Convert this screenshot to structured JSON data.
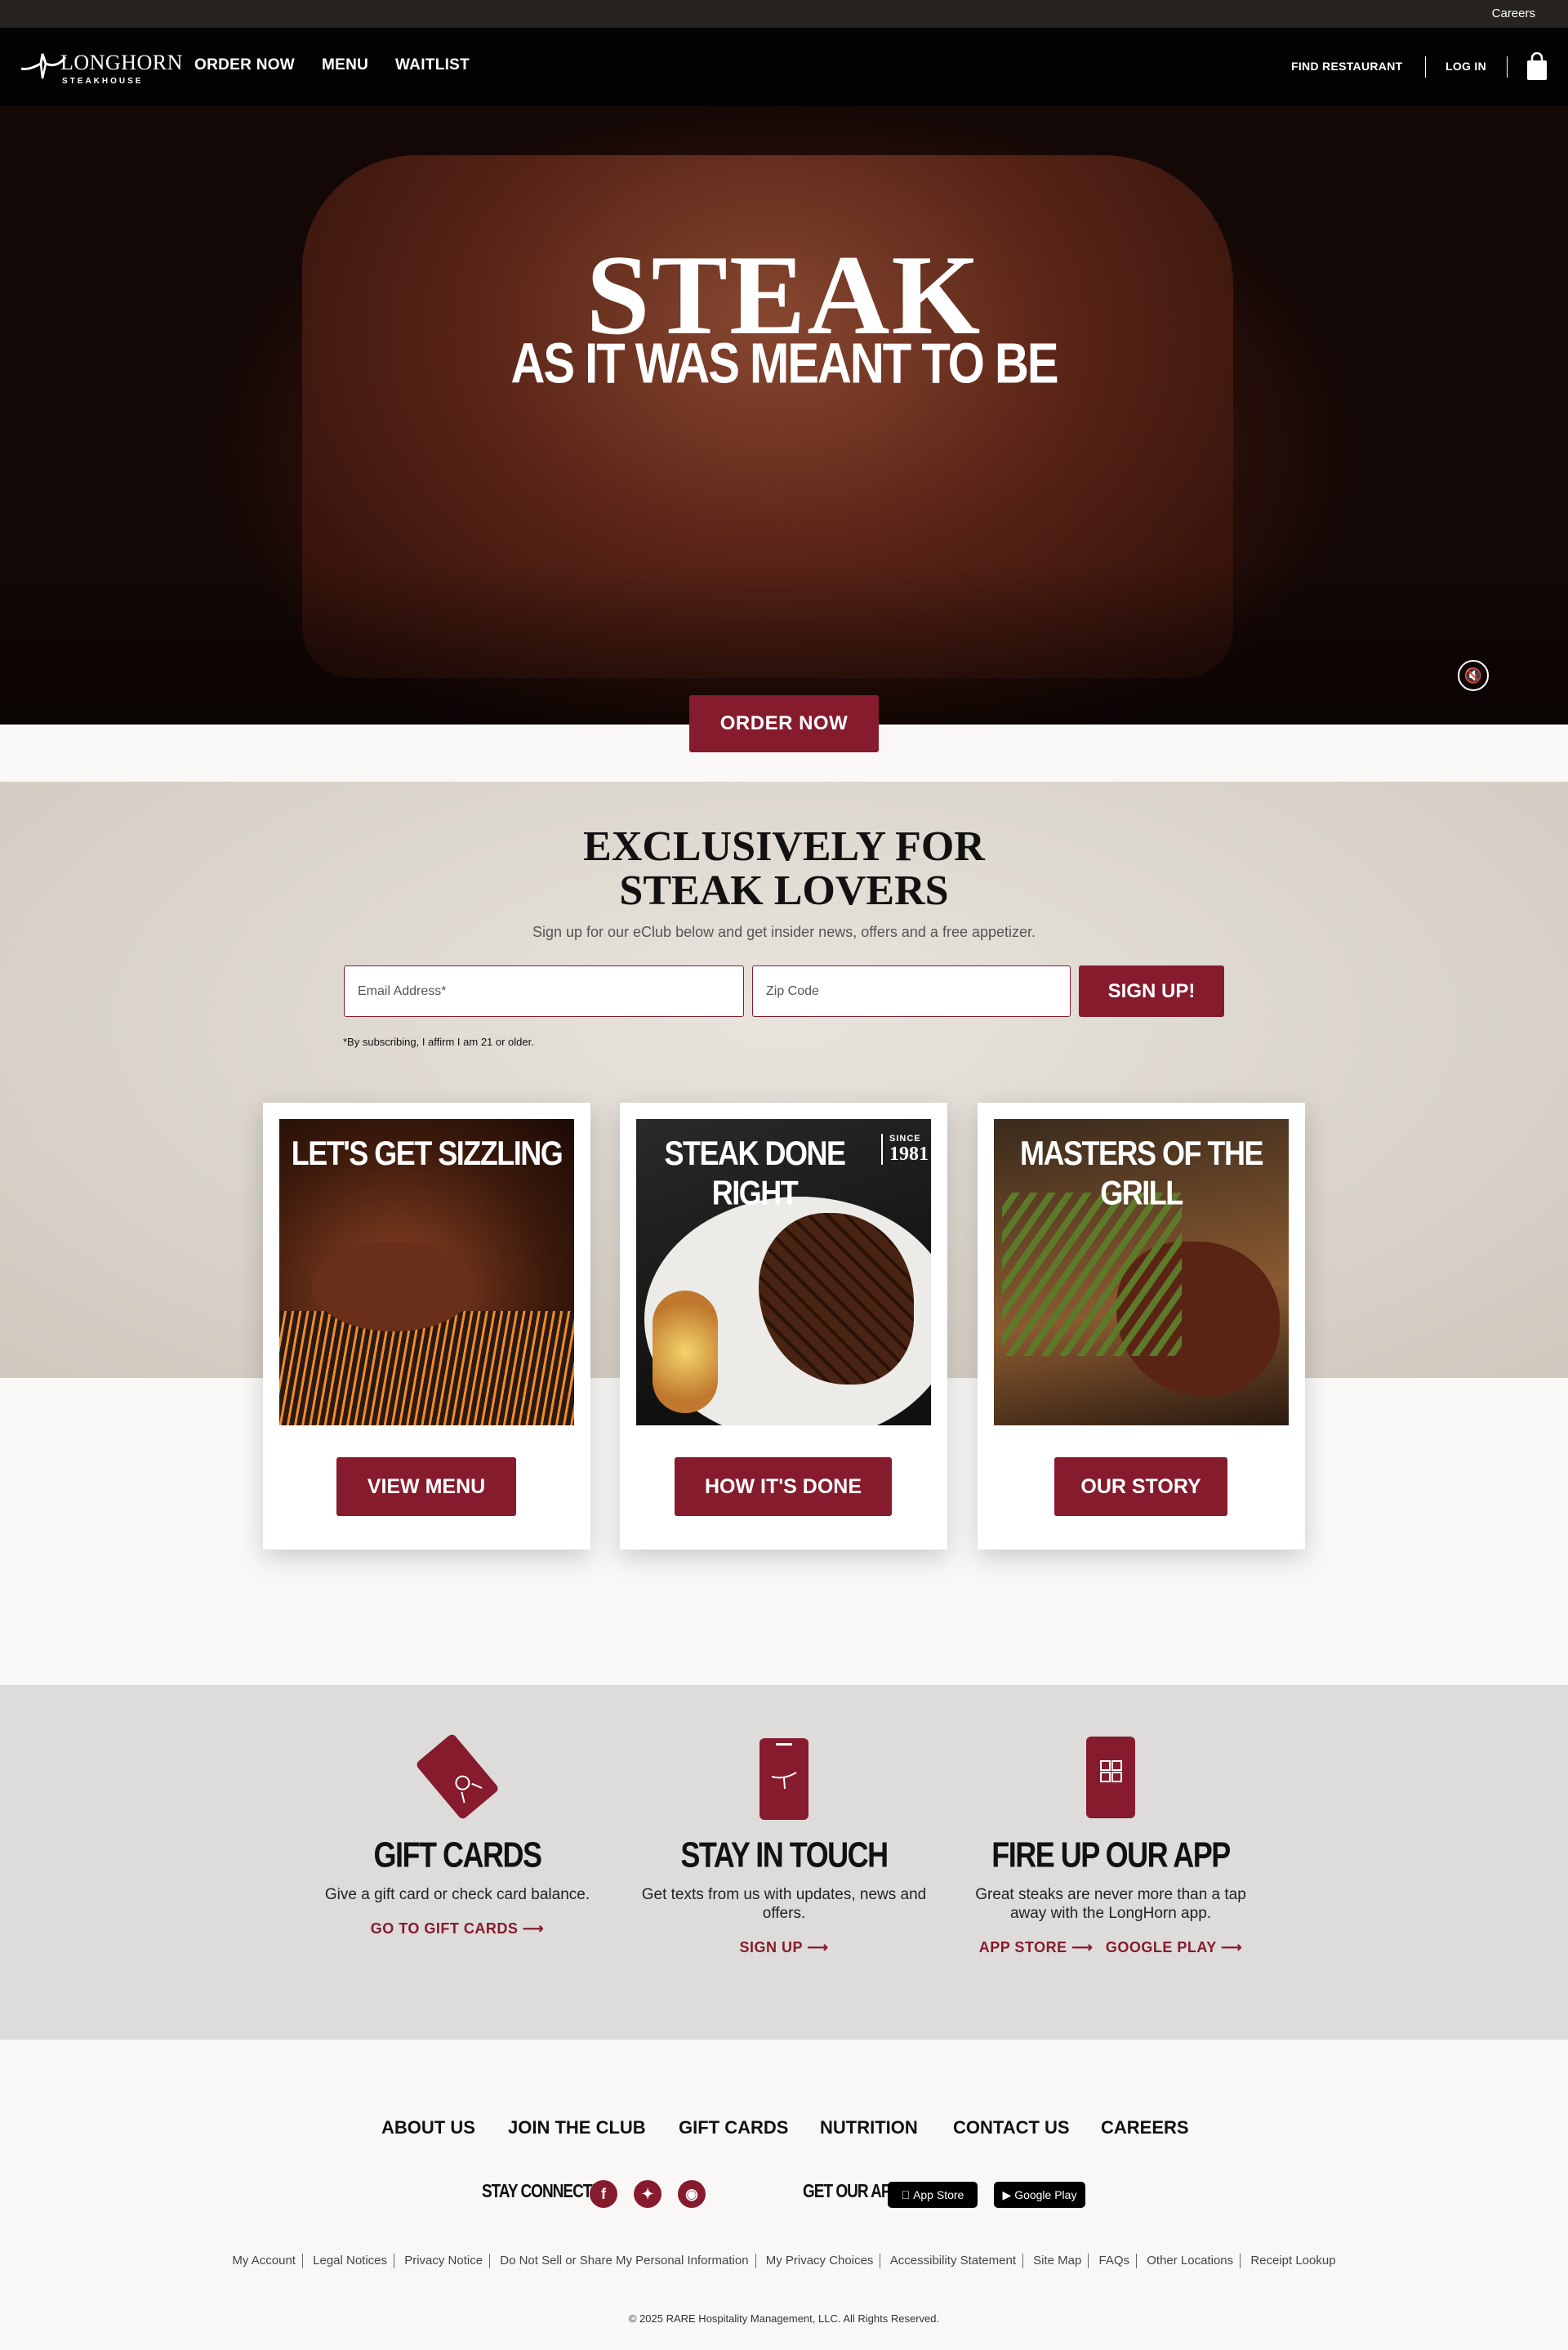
{
  "utility": {
    "careers": "Careers"
  },
  "header": {
    "logo_line1": "LONGHORN",
    "logo_line2": "STEAKHOUSE",
    "nav": [
      "ORDER NOW",
      "MENU",
      "WAITLIST"
    ],
    "find_restaurant": "FIND RESTAURANT",
    "log_in": "LOG IN"
  },
  "hero": {
    "title": "STEAK",
    "subtitle": "AS IT WAS MEANT TO BE",
    "order_button": "ORDER NOW"
  },
  "eclub": {
    "title_line1": "EXCLUSIVELY FOR",
    "title_line2": "STEAK LOVERS",
    "description": "Sign up for our eClub below and get insider news, offers and a free appetizer.",
    "email_placeholder": "Email Address*",
    "zip_placeholder": "Zip Code",
    "signup_button": "SIGN UP!",
    "affirm": "*By subscribing, I affirm I am 21 or older."
  },
  "cards": [
    {
      "caption": "LET'S GET SIZZLING",
      "button": "VIEW MENU"
    },
    {
      "caption": "STEAK DONE RIGHT",
      "since": "SINCE",
      "year": "1981",
      "button": "HOW IT'S DONE"
    },
    {
      "caption": "MASTERS OF THE GRILL",
      "button": "OUR STORY"
    }
  ],
  "features": [
    {
      "title": "GIFT CARDS",
      "desc": "Give a gift card or check card balance.",
      "link": "GO TO GIFT CARDS"
    },
    {
      "title": "STAY IN TOUCH",
      "desc": "Get texts from us with updates, news and offers.",
      "link": "SIGN UP"
    },
    {
      "title": "FIRE UP OUR APP",
      "desc": "Great steaks are never more than a tap away with the LongHorn app.",
      "link_app_store": "APP STORE",
      "link_google_play": "GOOGLE PLAY"
    }
  ],
  "footer": {
    "nav": [
      "ABOUT US",
      "JOIN THE CLUB",
      "GIFT CARDS",
      "NUTRITION",
      "CONTACT US",
      "CAREERS"
    ],
    "stay_connected": "STAY CONNECTED",
    "get_our_app": "GET OUR APP",
    "app_store_badge": "App Store",
    "google_play_badge": "Google Play",
    "legal": [
      "My Account",
      "Legal Notices",
      "Privacy Notice",
      "Do Not Sell or Share My Personal Information",
      "My Privacy Choices",
      "Accessibility Statement",
      "Site Map",
      "FAQs",
      "Other Locations",
      "Receipt Lookup"
    ],
    "copyright": "© 2025 RARE Hospitality Management, LLC. All Rights Reserved."
  },
  "colors": {
    "brand": "#851b2c",
    "header_bg": "#030303",
    "utility_bg": "#262321"
  }
}
